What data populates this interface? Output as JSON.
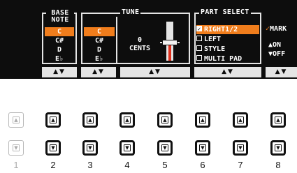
{
  "base_note": {
    "title_line1": "BASE",
    "title_line2": "NOTE",
    "items": [
      "C",
      "C#",
      "D",
      "E♭"
    ],
    "selected_index": 0
  },
  "tune": {
    "title": "TUNE",
    "notes": [
      "C",
      "C#",
      "D",
      "E♭"
    ],
    "selected_index": 0,
    "value": "0",
    "unit": "CENTS"
  },
  "part_select": {
    "title": "PART SELECT",
    "items": [
      {
        "label": "RIGHT1/2",
        "checked": true,
        "selected": true
      },
      {
        "label": "LEFT",
        "checked": false,
        "selected": false
      },
      {
        "label": "STYLE",
        "checked": false,
        "selected": false
      },
      {
        "label": "MULTI PAD",
        "checked": false,
        "selected": false
      }
    ]
  },
  "mark": {
    "title": "MARK",
    "on_label": "ON",
    "off_label": "OFF"
  },
  "updown_label": "▲▼",
  "buttons": {
    "up_symbol": "▲",
    "down_symbol": "▼",
    "columns": [
      "1",
      "2",
      "3",
      "4",
      "5",
      "6",
      "7",
      "8"
    ],
    "inactive_column": "1"
  },
  "colors": {
    "screen_bg": "#0d0d0d",
    "highlight": "#f07d1c",
    "text": "#ffffff",
    "frame": "#e4e4e4"
  }
}
